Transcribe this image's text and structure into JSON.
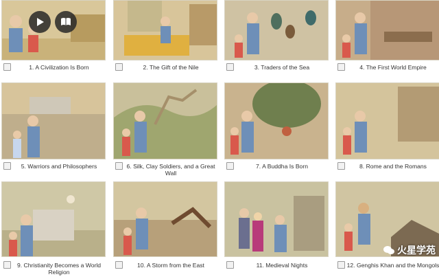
{
  "episodes": [
    {
      "label": "1. A Civilization Is Born"
    },
    {
      "label": "2. The Gift of the Nile"
    },
    {
      "label": "3. Traders of the Sea"
    },
    {
      "label": "4. The First World Empire"
    },
    {
      "label": "5. Warriors and Philosophers"
    },
    {
      "label": "6. Silk, Clay Soldiers, and a Great Wall"
    },
    {
      "label": "7. A Buddha Is Born"
    },
    {
      "label": "8. Rome and the Romans"
    },
    {
      "label": "9. Christianity Becomes a World Religion"
    },
    {
      "label": "10. A Storm from the East"
    },
    {
      "label": "11. Medieval Nights"
    },
    {
      "label": "12. Genghis Khan and the Mongols"
    }
  ],
  "watermark": {
    "text": "火星学苑"
  },
  "media": {
    "play_icon": "play-icon",
    "book_icon": "book-icon"
  }
}
